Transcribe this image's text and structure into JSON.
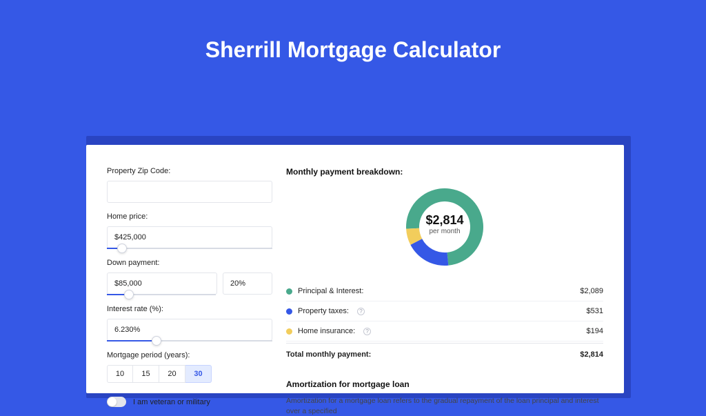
{
  "title": "Sherrill Mortgage Calculator",
  "colors": {
    "principal": "#49a98c",
    "taxes": "#3558e6",
    "insurance": "#f2cd5c"
  },
  "form": {
    "zip_label": "Property Zip Code:",
    "zip_value": "",
    "home_price_label": "Home price:",
    "home_price_value": "$425,000",
    "home_price_slider_pct": 9,
    "down_payment_label": "Down payment:",
    "down_payment_value": "$85,000",
    "down_payment_pct_value": "20%",
    "down_payment_slider_pct": 20,
    "interest_label": "Interest rate (%):",
    "interest_value": "6.230%",
    "interest_slider_pct": 30,
    "period_label": "Mortgage period (years):",
    "period_options": [
      "10",
      "15",
      "20",
      "30"
    ],
    "period_active_index": 3,
    "veteran_label": "I am veteran or military"
  },
  "breakdown": {
    "title": "Monthly payment breakdown:",
    "center_amount": "$2,814",
    "center_sub": "per month",
    "items": [
      {
        "label": "Principal & Interest:",
        "value": "$2,089",
        "colorKey": "principal",
        "help": false
      },
      {
        "label": "Property taxes:",
        "value": "$531",
        "colorKey": "taxes",
        "help": true
      },
      {
        "label": "Home insurance:",
        "value": "$194",
        "colorKey": "insurance",
        "help": true
      }
    ],
    "total_label": "Total monthly payment:",
    "total_value": "$2,814"
  },
  "amort": {
    "title": "Amortization for mortgage loan",
    "text": "Amortization for a mortgage loan refers to the gradual repayment of the loan principal and interest over a specified"
  },
  "chart_data": {
    "type": "pie",
    "title": "Monthly payment breakdown",
    "categories": [
      "Principal & Interest",
      "Property taxes",
      "Home insurance"
    ],
    "values": [
      2089,
      531,
      194
    ],
    "total": 2814,
    "colors": [
      "#49a98c",
      "#3558e6",
      "#f2cd5c"
    ]
  }
}
